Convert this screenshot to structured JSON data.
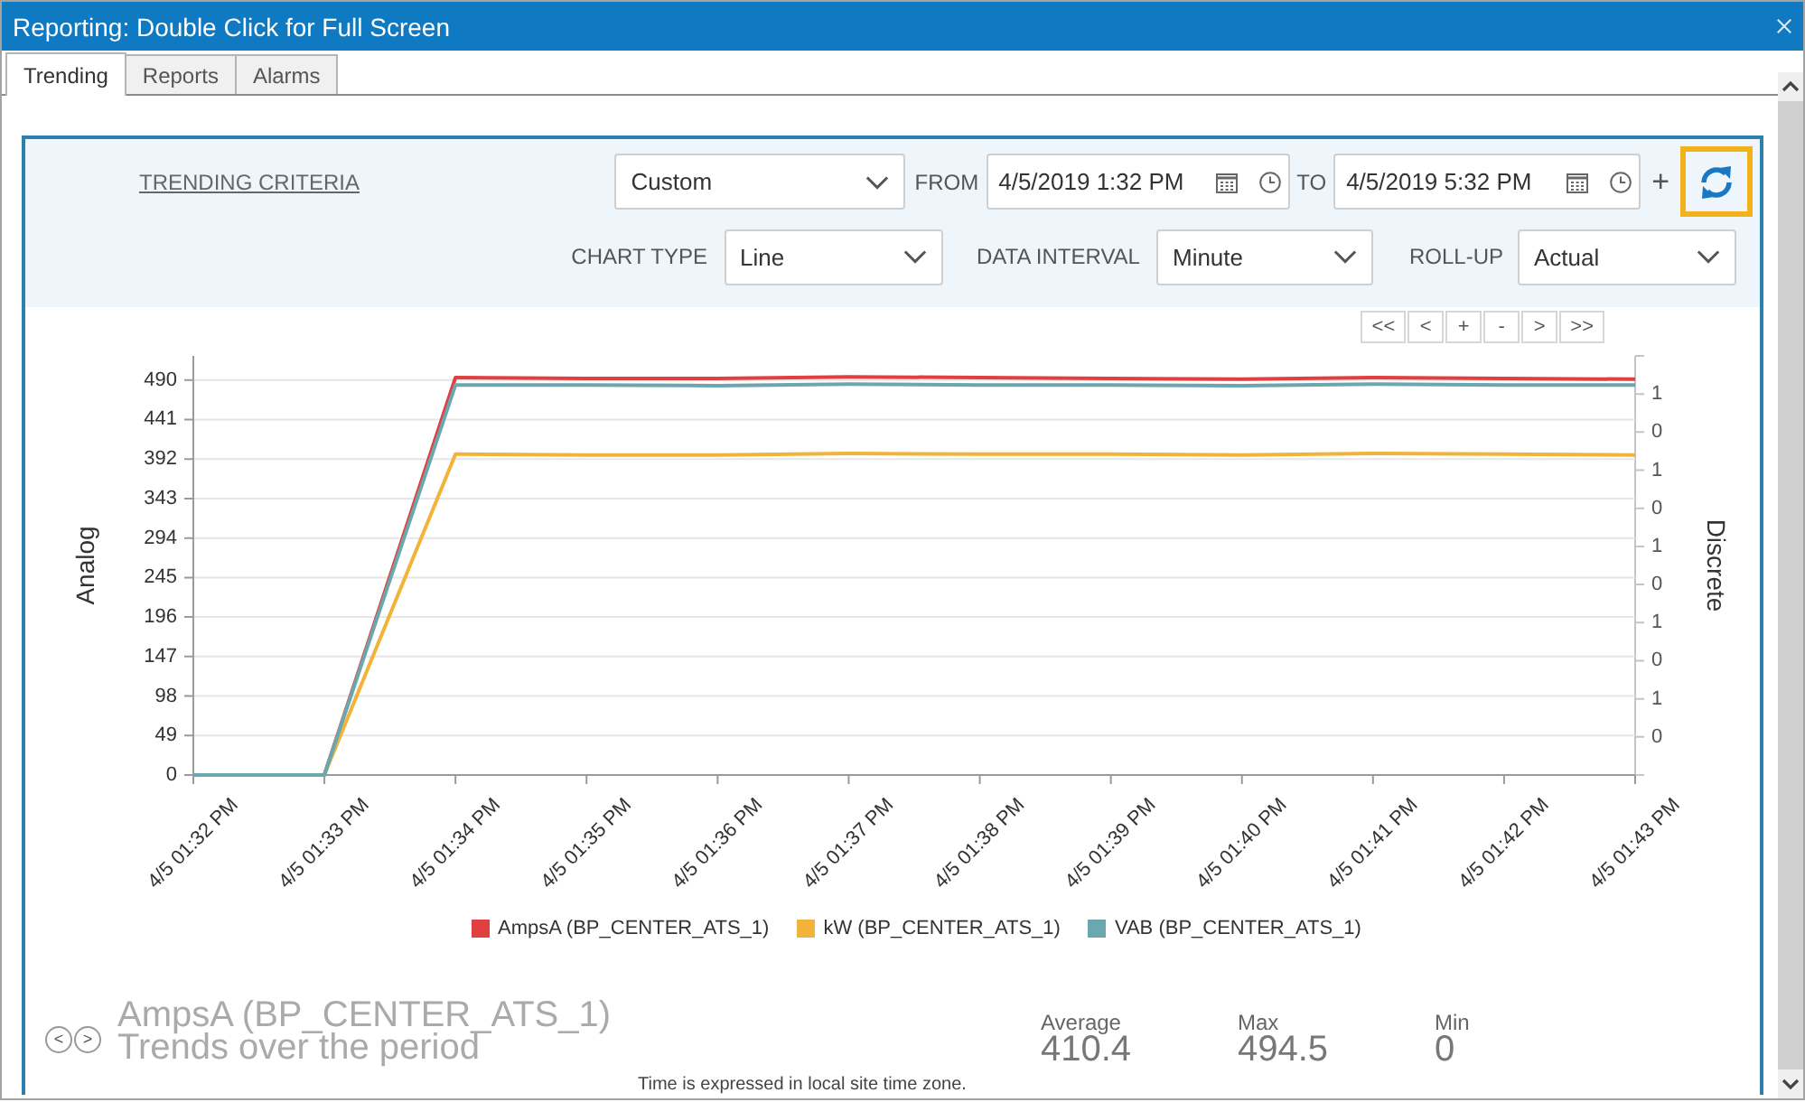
{
  "window": {
    "title": "Reporting: Double Click for Full Screen"
  },
  "tabs": [
    {
      "label": "Trending",
      "selected": true
    },
    {
      "label": "Reports",
      "selected": false
    },
    {
      "label": "Alarms",
      "selected": false
    }
  ],
  "criteria": {
    "link": "TRENDING CRITERIA",
    "range": {
      "value": "Custom"
    },
    "from_label": "FROM",
    "from": {
      "value": "4/5/2019 1:32 PM"
    },
    "to_label": "TO",
    "to": {
      "value": "4/5/2019 5:32 PM"
    },
    "add": "+",
    "refresh_button": {
      "highlighted": true
    },
    "chart_type": {
      "label": "CHART TYPE",
      "value": "Line"
    },
    "data_interval": {
      "label": "DATA INTERVAL",
      "value": "Minute"
    },
    "roll_up": {
      "label": "ROLL-UP",
      "value": "Actual"
    }
  },
  "chart_nav": [
    "<<",
    "<",
    "+",
    "-",
    ">",
    ">>"
  ],
  "chart": {
    "secondary_axis": {
      "label": "Discrete",
      "tick_labels": [
        "1",
        "0",
        "1",
        "0",
        "1",
        "0",
        "1",
        "0",
        "1",
        "0"
      ]
    },
    "chart_data": {
      "type": "line",
      "ylabel": "Analog",
      "grid": true,
      "categories": [
        "4/5 01:32 PM",
        "4/5 01:33 PM",
        "4/5 01:34 PM",
        "4/5 01:35 PM",
        "4/5 01:36 PM",
        "4/5 01:37 PM",
        "4/5 01:38 PM",
        "4/5 01:39 PM",
        "4/5 01:40 PM",
        "4/5 01:41 PM",
        "4/5 01:42 PM",
        "4/5 01:43 PM"
      ],
      "series": [
        {
          "name": "AmpsA (BP_CENTER_ATS_1)",
          "color": "#e0403f",
          "values": [
            0,
            0,
            493,
            492,
            492,
            494,
            493,
            492,
            491,
            493,
            492,
            491
          ]
        },
        {
          "name": "kW (BP_CENTER_ATS_1)",
          "color": "#f2b33a",
          "values": [
            0,
            0,
            398,
            397,
            397,
            399,
            398,
            398,
            397,
            399,
            398,
            397
          ]
        },
        {
          "name": "VAB (BP_CENTER_ATS_1)",
          "color": "#6aa7ae",
          "values": [
            0,
            0,
            484,
            484,
            483,
            485,
            484,
            484,
            483,
            485,
            484,
            484
          ]
        }
      ],
      "ylim": [
        0,
        520
      ],
      "yticks": [
        0,
        49,
        98,
        147,
        196,
        245,
        294,
        343,
        392,
        441,
        490
      ]
    }
  },
  "summary": {
    "previous": "<",
    "next": ">",
    "title": "AmpsA (BP_CENTER_ATS_1)",
    "subtitle": "Trends over the period",
    "stats": [
      {
        "label": "Average",
        "value": "410.4"
      },
      {
        "label": "Max",
        "value": "494.5"
      },
      {
        "label": "Min",
        "value": "0"
      }
    ],
    "note": "Time is expressed in local site time zone."
  }
}
